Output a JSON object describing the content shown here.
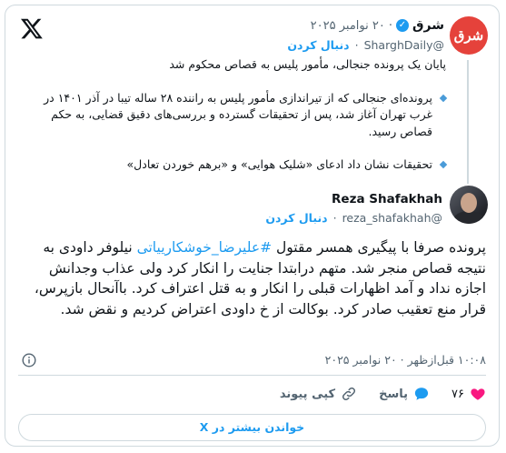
{
  "quoted": {
    "name": "شرق",
    "avatar_text": "شرق",
    "handle": "@SharghDaily",
    "date": "۲۰ نوامبر ۲۰۲۵",
    "follow_label": "دنبال کردن",
    "headline": "پایان یک پرونده جنجالی، مأمور پلیس به قصاص محکوم شد",
    "bullets": [
      "پرونده‌ای جنجالی که از تیراندازی مأمور پلیس به راننده ۲۸ ساله تیبا در آذر ۱۴۰۱ در غرب تهران آغاز شد، پس از تحقیقات گسترده و بررسی‌های دقیق قضایی، به حکم قصاص رسید.",
      "تحقیقات نشان داد ادعای «شلیک هوایی» و «برهم خوردن تعادل»"
    ]
  },
  "author": {
    "name": "Reza Shafakhah",
    "handle": "@reza_shafakhah",
    "follow_label": "دنبال کردن"
  },
  "tweet": {
    "text_before": "پرونده صرفا با پیگیری همسر مقتول ",
    "hashtag": "#علیرضا_خوشکارییاتی",
    "text_after": " نیلوفر داودی به نتیجه قصاص منجر شد. متهم درابتدا جنایت را انکار کرد ولی عذاب وجدانش اجازه نداد و آمد اظهارات قبلی را انکار و به قتل اعتراف کرد. باآنحال بازپرس، قرار منع تعقیب صادر کرد. بوکالت از خ داودی اعتراض کردیم و نقض شد.",
    "timestamp": "۱۰:۰۸ قبل‌ازظهر · ۲۰ نوامبر ۲۰۲۵"
  },
  "actions": {
    "like_count": "۷۶",
    "reply_label": "پاسخ",
    "copy_link_label": "کپی پیوند"
  },
  "more_label": "خواندن بیشتر در X",
  "colors": {
    "accent": "#1d9bf0",
    "like": "#f91880",
    "shargh_brand": "#e5423b"
  }
}
